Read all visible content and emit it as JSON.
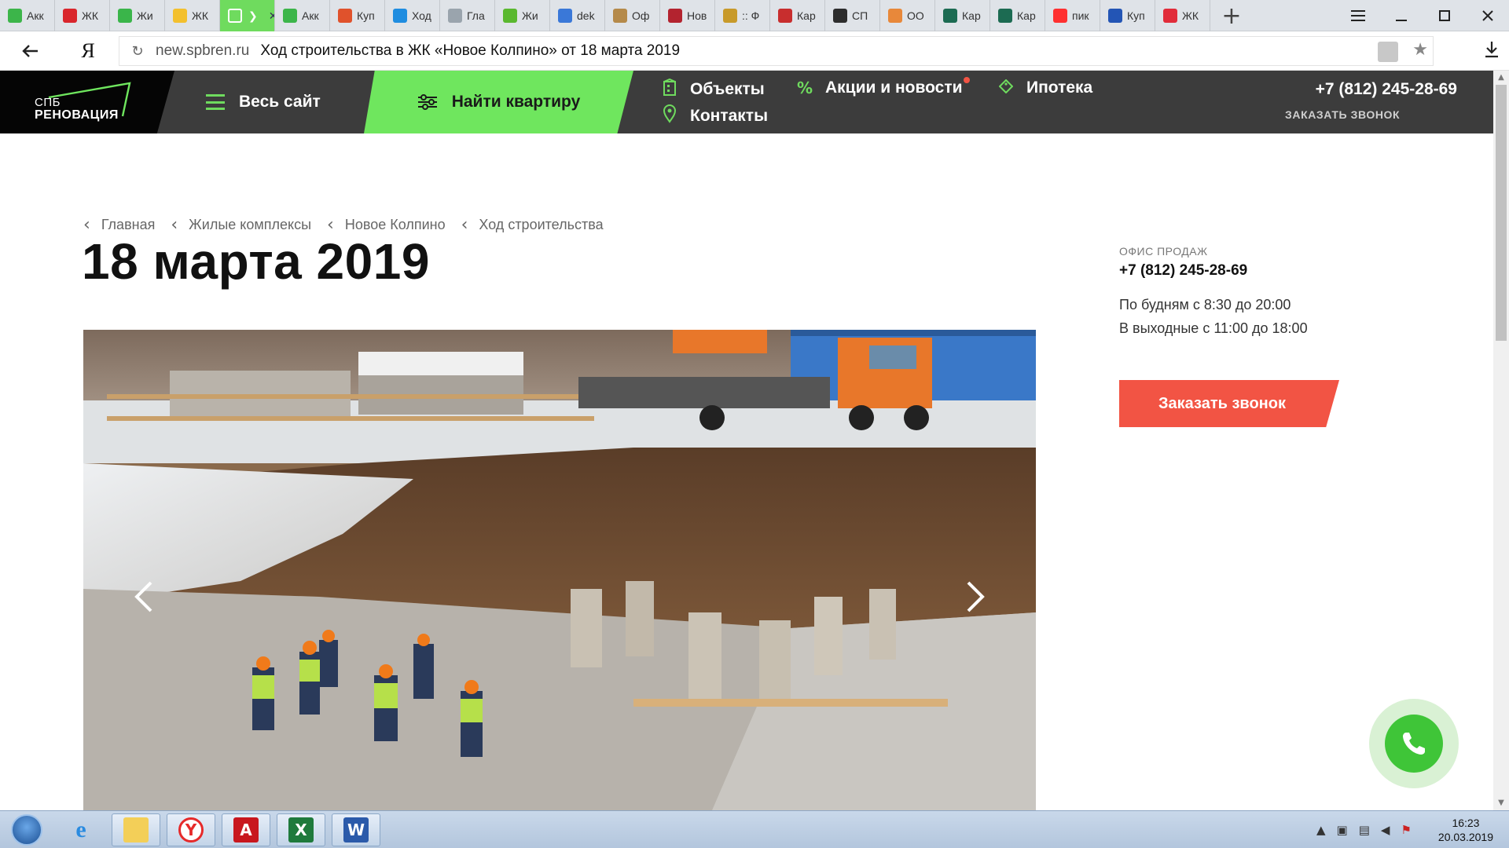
{
  "browser": {
    "tabs": [
      {
        "title": "Акк",
        "color": "#3cb54a",
        "icon": "green-leaf-icon"
      },
      {
        "title": "ЖК",
        "color": "#d9262c",
        "icon": "red-building-icon"
      },
      {
        "title": "Жи",
        "color": "#3ab54a",
        "icon": "green-pin-icon"
      },
      {
        "title": "ЖК",
        "color": "#f3c02e",
        "icon": "yellow-folder-icon"
      },
      {
        "title": "",
        "color": "#ffffff",
        "icon": "spbren-icon",
        "active": true
      },
      {
        "title": "Акк",
        "color": "#3cb54a",
        "icon": "green-leaf-icon"
      },
      {
        "title": "Куп",
        "color": "#e0522c",
        "icon": "hand-icon"
      },
      {
        "title": "Ход",
        "color": "#1f8de0",
        "icon": "blue-flag-icon"
      },
      {
        "title": "Гла",
        "color": "#9aa4ad",
        "icon": "page-icon"
      },
      {
        "title": "Жи",
        "color": "#5ab82f",
        "icon": "green-square-icon"
      },
      {
        "title": "dek",
        "color": "#3a78d8",
        "icon": "doc-icon"
      },
      {
        "title": "Оф",
        "color": "#b58a4a",
        "icon": "crest-icon"
      },
      {
        "title": "Нов",
        "color": "#b3232f",
        "icon": "bars-icon"
      },
      {
        "title": ":: Ф",
        "color": "#c89a2a",
        "icon": "eagle-icon"
      },
      {
        "title": "Кар",
        "color": "#c82e2e",
        "icon": "eagle-red-icon"
      },
      {
        "title": "СП",
        "color": "#2d2d2d",
        "icon": "check-dark-icon"
      },
      {
        "title": "ОО",
        "color": "#e8883a",
        "icon": "check-orange-icon"
      },
      {
        "title": "Кар",
        "color": "#1c6b52",
        "icon": "map-icon"
      },
      {
        "title": "Кар",
        "color": "#1c6b52",
        "icon": "map-icon"
      },
      {
        "title": "пик",
        "color": "#ff3030",
        "icon": "yandex-icon"
      },
      {
        "title": "Куп",
        "color": "#2355b5",
        "icon": "pik-icon"
      },
      {
        "title": "ЖК",
        "color": "#e12c3a",
        "icon": "red-tag-icon"
      }
    ],
    "new_tab_symbol": "+",
    "address": {
      "host": "new.spbren.ru",
      "page_title": "Ход строительства в ЖК «Новое Колпино» от 18 марта 2019"
    },
    "yandex_letter": "Я"
  },
  "header": {
    "logo_small": "СПБ",
    "logo_big": "РЕНОВАЦИЯ",
    "all_site": "Весь сайт",
    "find_flat": "Найти квартиру",
    "nav": {
      "objects": "Объекты",
      "contacts": "Контакты",
      "news": "Акции и новости",
      "mortgage": "Ипотека"
    },
    "phone": "+7 (812) 245-28-69",
    "callback": "ЗАКАЗАТЬ ЗВОНОК",
    "accent": "#6fe65e"
  },
  "breadcrumb": [
    "Главная",
    "Жилые комплексы",
    "Новое Колпино",
    "Ход строительства"
  ],
  "page_title": "18 марта 2019",
  "sidebar": {
    "office_label": "ОФИС ПРОДАЖ",
    "phone": "+7 (812) 245-28-69",
    "weekdays": "По будням с 8:30 до 20:00",
    "weekends": "В выходные с 11:00 до 18:00",
    "call_button": "Заказать звонок",
    "button_color": "#f25444"
  },
  "taskbar": {
    "time": "16:23",
    "date": "20.03.2019"
  }
}
